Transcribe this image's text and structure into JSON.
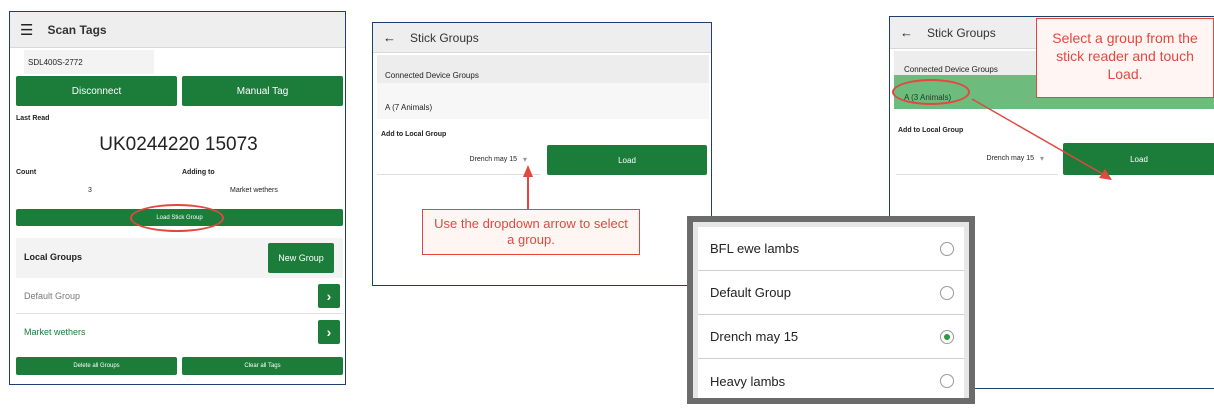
{
  "panel1": {
    "title": "Scan Tags",
    "device": "SDL400S-2772",
    "disconnect_label": "Disconnect",
    "manual_tag_label": "Manual Tag",
    "last_read_label": "Last Read",
    "last_read_value": "UK0244220 15073",
    "count_label": "Count",
    "adding_to_label": "Adding to",
    "count_value": "3",
    "adding_to_value": "Market wethers",
    "load_stick_group_label": "Load Stick Group",
    "local_groups_label": "Local Groups",
    "new_group_label": "New Group",
    "groups": [
      "Default Group",
      "Market wethers"
    ],
    "delete_all_label": "Delete all Groups",
    "clear_all_label": "Clear all Tags"
  },
  "panel2": {
    "title": "Stick Groups",
    "connected_label": "Connected Device Groups",
    "group_value": "A (7 Animals)",
    "add_local_label": "Add to Local Group",
    "dropdown_value": "Drench may 15",
    "load_label": "Load",
    "callout": "Use the dropdown arrow to select a group."
  },
  "panel3": {
    "title": "Stick Groups",
    "connected_label": "Connected Device Groups",
    "group_value": "A (3 Animals)",
    "add_local_label": "Add to Local Group",
    "dropdown_value": "Drench may 15",
    "load_label": "Load",
    "callout": "Select a group from the stick reader and touch Load."
  },
  "dropdown_list": {
    "items": [
      "BFL ewe lambs",
      "Default Group",
      "Drench may 15",
      "Heavy lambs"
    ],
    "selected_index": 2
  },
  "colors": {
    "accent_green": "#1c7c3a",
    "annotation_red": "#e2483f"
  }
}
